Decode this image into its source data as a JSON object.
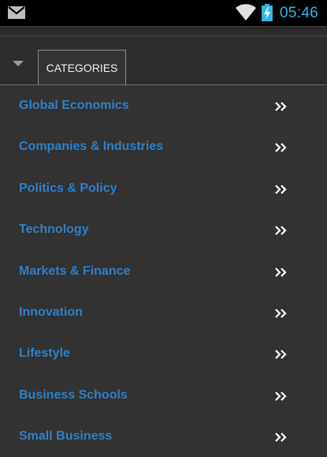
{
  "status_bar": {
    "time": "05:46",
    "icons": [
      "mail-icon",
      "wifi-icon",
      "battery-charging-icon"
    ],
    "clock_color": "#33b5e5"
  },
  "header": {
    "dropdown_icon": "dropdown-triangle-icon",
    "tab_label": "CATEGORIES"
  },
  "categories": [
    {
      "label": "Global Economics",
      "icon": "double-chevron-right-icon"
    },
    {
      "label": "Companies & Industries",
      "icon": "double-chevron-right-icon"
    },
    {
      "label": "Politics & Policy",
      "icon": "double-chevron-right-icon"
    },
    {
      "label": "Technology",
      "icon": "double-chevron-right-icon"
    },
    {
      "label": "Markets & Finance",
      "icon": "double-chevron-right-icon"
    },
    {
      "label": "Innovation",
      "icon": "double-chevron-right-icon"
    },
    {
      "label": "Lifestyle",
      "icon": "double-chevron-right-icon"
    },
    {
      "label": "Business Schools",
      "icon": "double-chevron-right-icon"
    },
    {
      "label": "Small Business",
      "icon": "double-chevron-right-icon"
    }
  ],
  "colors": {
    "background": "#323232",
    "link": "#2f80c8",
    "chevron": "#ffffff"
  }
}
